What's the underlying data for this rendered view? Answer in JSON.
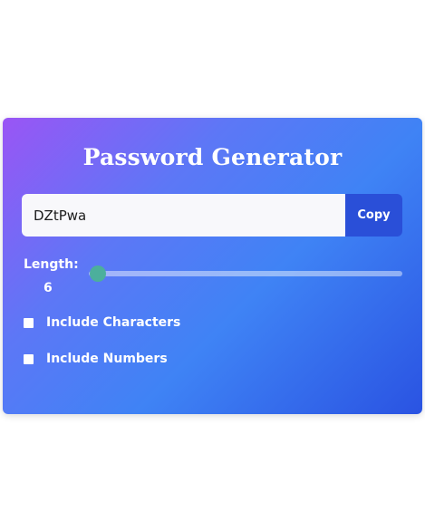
{
  "app": {
    "title": "Password Generator"
  },
  "password": {
    "value": "DZtPwa",
    "copy_label": "Copy"
  },
  "length": {
    "label": "Length:",
    "value": "6",
    "slider_fraction": 0.03
  },
  "options": [
    {
      "label": "Include Characters",
      "checked": false
    },
    {
      "label": "Include Numbers",
      "checked": false
    }
  ],
  "colors": {
    "gradient_start": "#9a55f5",
    "gradient_end": "#2a53e2",
    "copy_button": "#2a4fd8",
    "slider_thumb": "#4caf9c"
  }
}
